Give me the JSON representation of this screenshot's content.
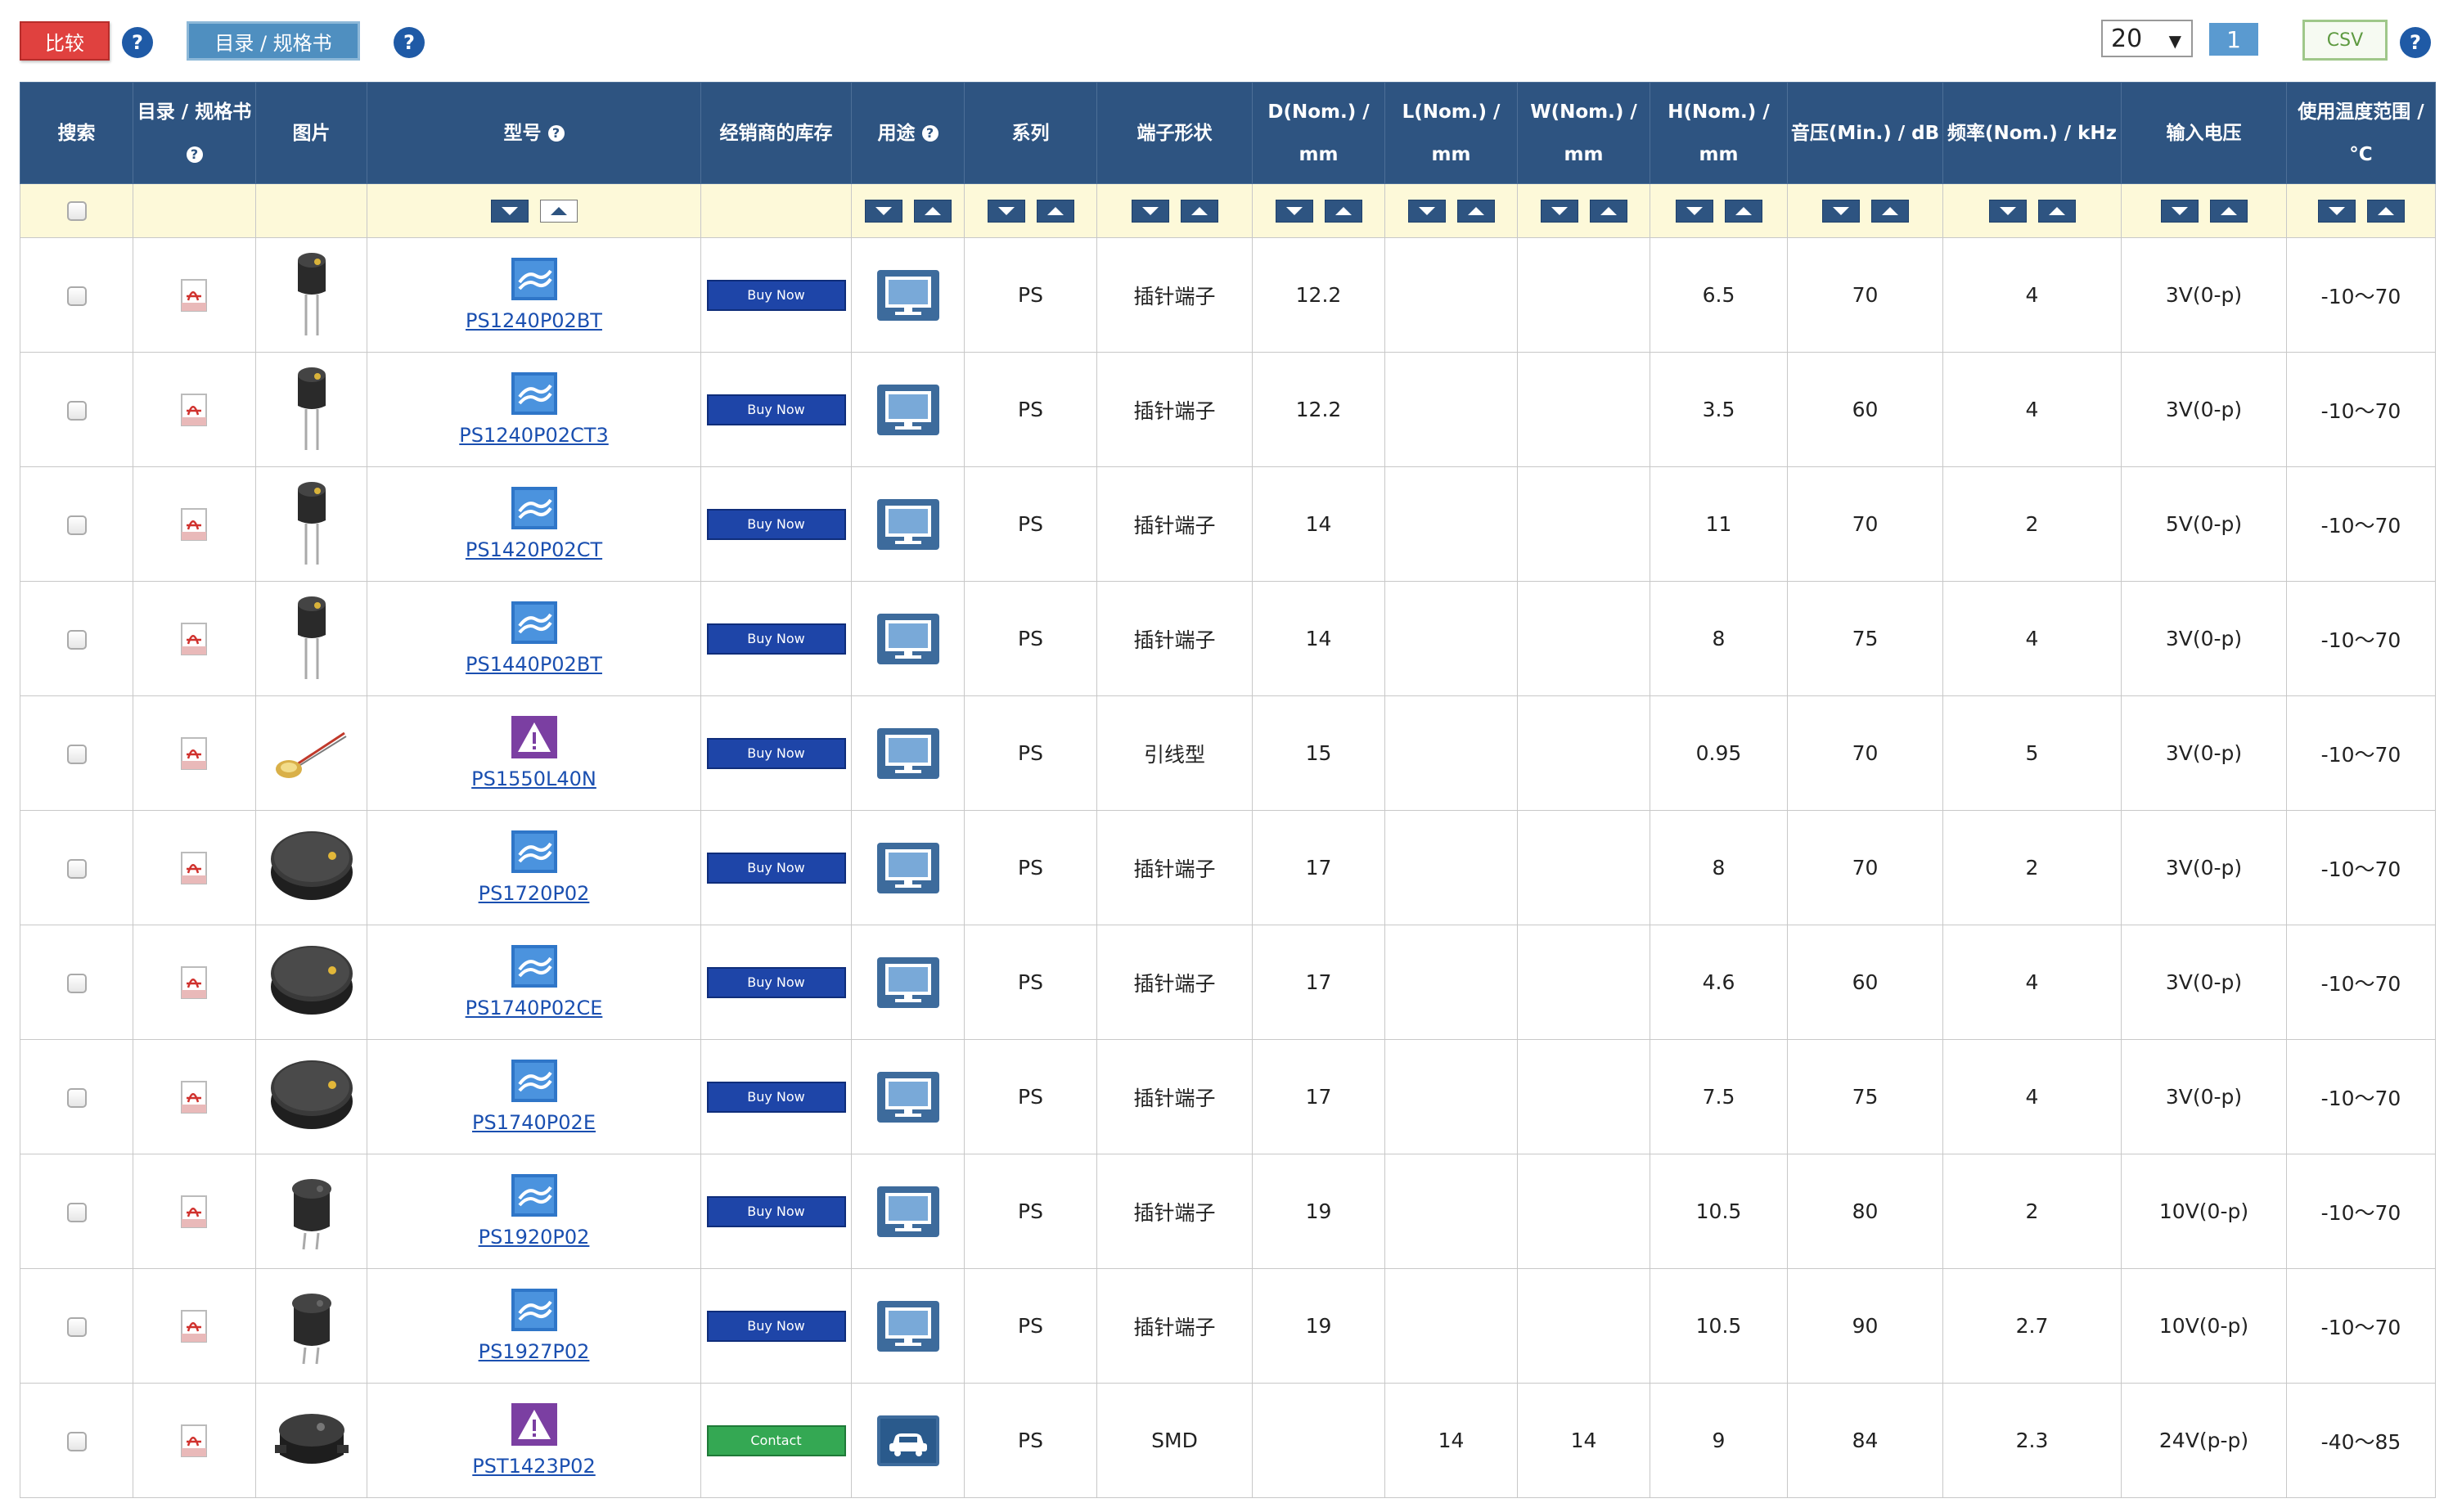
{
  "toolbar": {
    "compare_label": "比较",
    "catalog_label": "目录 / 规格书",
    "help_glyph": "?",
    "per_page_value": "20",
    "current_page": "1",
    "csv_label": "CSV"
  },
  "columns": [
    {
      "label": "搜索",
      "help": false
    },
    {
      "label": "目录 / 规格书",
      "help": true
    },
    {
      "label": "图片",
      "help": false
    },
    {
      "label": "型号",
      "help": true
    },
    {
      "label": "经销商的库存",
      "help": false
    },
    {
      "label": "用途",
      "help": true
    },
    {
      "label": "系列",
      "help": false
    },
    {
      "label": "端子形状",
      "help": false
    },
    {
      "label": "D(Nom.) / mm",
      "help": false
    },
    {
      "label": "L(Nom.) / mm",
      "help": false
    },
    {
      "label": "W(Nom.) / mm",
      "help": false
    },
    {
      "label": "H(Nom.) / mm",
      "help": false
    },
    {
      "label": "音压(Min.) / dB",
      "help": false
    },
    {
      "label": "频率(Nom.) / kHz",
      "help": false
    },
    {
      "label": "输入电压",
      "help": false
    },
    {
      "label": "使用温度范围 / °C",
      "help": false
    }
  ],
  "buttons": {
    "buy_now": "Buy Now",
    "contact": "Contact"
  },
  "rows": [
    {
      "part": "PS1240P02BT",
      "part_icon": "blue-product-icon",
      "image": "buzzer-small-pins",
      "action": "buy",
      "use": "monitor-icon",
      "series": "PS",
      "terminal": "插针端子",
      "d": "12.2",
      "l": "",
      "w": "",
      "h": "6.5",
      "spl": "70",
      "freq": "4",
      "voltage": "3V(0-p)",
      "temp": "-10～70"
    },
    {
      "part": "PS1240P02CT3",
      "part_icon": "blue-product-icon",
      "image": "buzzer-small-pins",
      "action": "buy",
      "use": "monitor-icon",
      "series": "PS",
      "terminal": "插针端子",
      "d": "12.2",
      "l": "",
      "w": "",
      "h": "3.5",
      "spl": "60",
      "freq": "4",
      "voltage": "3V(0-p)",
      "temp": "-10～70"
    },
    {
      "part": "PS1420P02CT",
      "part_icon": "blue-product-icon",
      "image": "buzzer-small-pins",
      "action": "buy",
      "use": "monitor-icon",
      "series": "PS",
      "terminal": "插针端子",
      "d": "14",
      "l": "",
      "w": "",
      "h": "11",
      "spl": "70",
      "freq": "2",
      "voltage": "5V(0-p)",
      "temp": "-10～70"
    },
    {
      "part": "PS1440P02BT",
      "part_icon": "blue-product-icon",
      "image": "buzzer-small-pins",
      "action": "buy",
      "use": "monitor-icon",
      "series": "PS",
      "terminal": "插针端子",
      "d": "14",
      "l": "",
      "w": "",
      "h": "8",
      "spl": "75",
      "freq": "4",
      "voltage": "3V(0-p)",
      "temp": "-10～70"
    },
    {
      "part": "PS1550L40N",
      "part_icon": "warning-icon",
      "image": "lead-wire-disc",
      "action": "buy",
      "use": "monitor-icon",
      "series": "PS",
      "terminal": "引线型",
      "d": "15",
      "l": "",
      "w": "",
      "h": "0.95",
      "spl": "70",
      "freq": "5",
      "voltage": "3V(0-p)",
      "temp": "-10～70"
    },
    {
      "part": "PS1720P02",
      "part_icon": "blue-product-icon",
      "image": "buzzer-large",
      "action": "buy",
      "use": "monitor-icon",
      "series": "PS",
      "terminal": "插针端子",
      "d": "17",
      "l": "",
      "w": "",
      "h": "8",
      "spl": "70",
      "freq": "2",
      "voltage": "3V(0-p)",
      "temp": "-10～70"
    },
    {
      "part": "PS1740P02CE",
      "part_icon": "blue-product-icon",
      "image": "buzzer-large",
      "action": "buy",
      "use": "monitor-icon",
      "series": "PS",
      "terminal": "插针端子",
      "d": "17",
      "l": "",
      "w": "",
      "h": "4.6",
      "spl": "60",
      "freq": "4",
      "voltage": "3V(0-p)",
      "temp": "-10～70"
    },
    {
      "part": "PS1740P02E",
      "part_icon": "blue-product-icon",
      "image": "buzzer-large",
      "action": "buy",
      "use": "monitor-icon",
      "series": "PS",
      "terminal": "插针端子",
      "d": "17",
      "l": "",
      "w": "",
      "h": "7.5",
      "spl": "75",
      "freq": "4",
      "voltage": "3V(0-p)",
      "temp": "-10～70"
    },
    {
      "part": "PS1920P02",
      "part_icon": "blue-product-icon",
      "image": "buzzer-tall",
      "action": "buy",
      "use": "monitor-icon",
      "series": "PS",
      "terminal": "插针端子",
      "d": "19",
      "l": "",
      "w": "",
      "h": "10.5",
      "spl": "80",
      "freq": "2",
      "voltage": "10V(0-p)",
      "temp": "-10～70"
    },
    {
      "part": "PS1927P02",
      "part_icon": "blue-product-icon",
      "image": "buzzer-tall",
      "action": "buy",
      "use": "monitor-icon",
      "series": "PS",
      "terminal": "插针端子",
      "d": "19",
      "l": "",
      "w": "",
      "h": "10.5",
      "spl": "90",
      "freq": "2.7",
      "voltage": "10V(0-p)",
      "temp": "-10～70"
    },
    {
      "part": "PST1423P02",
      "part_icon": "warning-icon",
      "image": "buzzer-smd",
      "action": "contact",
      "use": "car-icon",
      "series": "PS",
      "terminal": "SMD",
      "d": "",
      "l": "14",
      "w": "14",
      "h": "9",
      "spl": "84",
      "freq": "2.3",
      "voltage": "24V(p-p)",
      "temp": "-40～85"
    }
  ]
}
